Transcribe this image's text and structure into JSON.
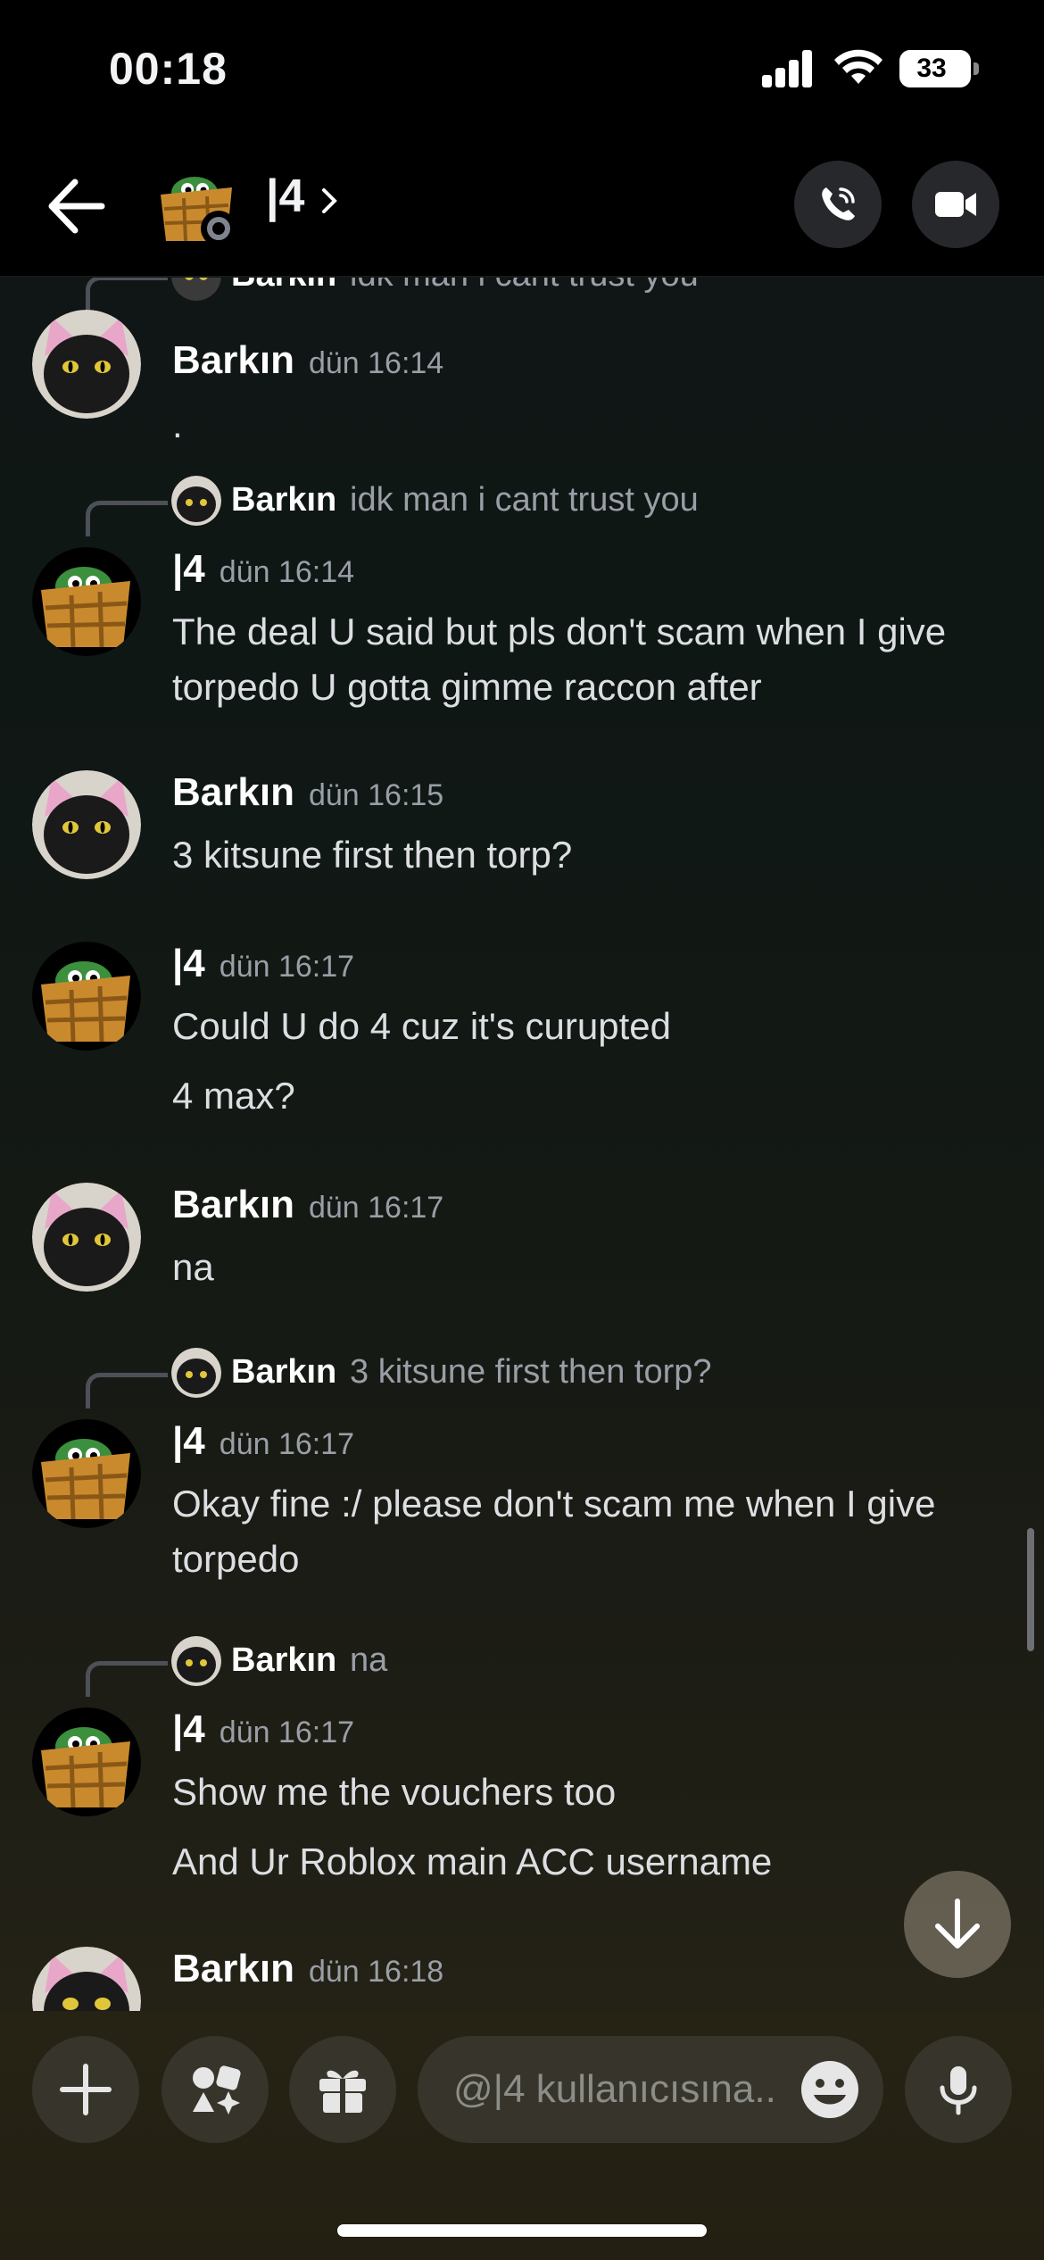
{
  "status_bar": {
    "time": "00:18",
    "battery": "33"
  },
  "header": {
    "channel_name": "|4"
  },
  "top_partial": {
    "author": "Barkın",
    "text": "idk man  i cant trust you"
  },
  "messages": [
    {
      "author": "Barkın",
      "timestamp": "dün 16:14",
      "lines": [
        "."
      ]
    },
    {
      "reply": {
        "author": "Barkın",
        "text": "idk man  i cant trust you"
      },
      "author": "|4",
      "timestamp": "dün 16:14",
      "lines": [
        "The deal U said but pls don't scam when I give torpedo U gotta gimme raccon after"
      ]
    },
    {
      "author": "Barkın",
      "timestamp": "dün 16:15",
      "lines": [
        "3 kitsune first then torp?"
      ]
    },
    {
      "author": "|4",
      "timestamp": "dün 16:17",
      "lines": [
        "Could U do 4 cuz it's curupted",
        "4 max?"
      ]
    },
    {
      "author": "Barkın",
      "timestamp": "dün 16:17",
      "lines": [
        "na"
      ]
    },
    {
      "reply": {
        "author": "Barkın",
        "text": "3 kitsune first then torp?"
      },
      "author": "|4",
      "timestamp": "dün 16:17",
      "lines": [
        "Okay fine :/ please don't scam me when I give torpedo"
      ]
    },
    {
      "reply": {
        "author": "Barkın",
        "text": "na"
      },
      "author": "|4",
      "timestamp": "dün 16:17",
      "lines": [
        "Show me the vouchers too",
        "And Ur Roblox main ACC username"
      ]
    },
    {
      "author": "Barkın",
      "timestamp": "dün 16:18",
      "lines": []
    }
  ],
  "composer": {
    "placeholder": "@|4 kullanıcısına.."
  },
  "icons": {
    "back": "arrow-left-icon",
    "call": "phone-icon",
    "video": "video-camera-icon",
    "plus": "plus-icon",
    "apps": "apps-icon",
    "gift": "gift-icon",
    "emoji": "emoji-icon",
    "mic": "microphone-icon",
    "jump": "arrow-down-icon"
  },
  "colors": {
    "background": "#0f1715",
    "muted_text": "#9a9ea6",
    "status_offline": "#80848e"
  }
}
